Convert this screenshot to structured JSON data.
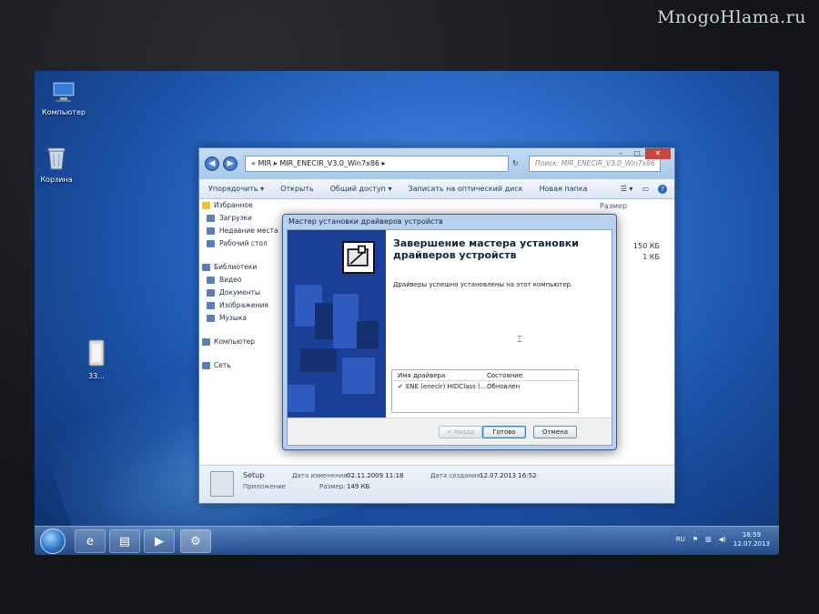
{
  "watermark": "MnogoHlama.ru",
  "desktop": {
    "icons": [
      {
        "label": "Компьютер",
        "icon": "computer-icon"
      },
      {
        "label": "Корзина",
        "icon": "recycle-bin-icon"
      },
      {
        "label": "33...",
        "icon": "folder-icon"
      }
    ]
  },
  "explorer": {
    "address": "«  MIR  ▸  MIR_ENECIR_V3.0_Win7x86  ▸",
    "search_placeholder": "Поиск: MIR_ENECIR_V3.0_Win7x86",
    "toolbar": {
      "organize": "Упорядочить ▾",
      "open": "Открыть",
      "share": "Общий доступ ▾",
      "burn": "Записать на оптический диск",
      "new_folder": "Новая папка"
    },
    "nav": {
      "favorites": "Избранное",
      "downloads": "Загрузки",
      "recent": "Недавние места",
      "desktop": "Рабочий стол",
      "libraries": "Библиотеки",
      "video": "Видео",
      "documents": "Документы",
      "images": "Изображения",
      "music": "Музыка",
      "computer": "Компьютер",
      "network": "Сеть"
    },
    "size_header": "Размер",
    "sizes": [
      "150 КБ",
      "1 КБ"
    ],
    "details": {
      "name": "Setup",
      "type": "Приложение",
      "modified_label": "Дата изменения:",
      "modified_value": "02.11.2009 11:18",
      "size_label": "Размер:",
      "size_value": "149 КБ",
      "created_label": "Дата создания:",
      "created_value": "12.07.2013 16:52"
    }
  },
  "wizard": {
    "title": "Мастер установки драйверов устройств",
    "heading": "Завершение мастера установки драйверов устройств",
    "message": "Драйверы успешно установлены на этот компьютер.",
    "table": {
      "col_name": "Имя драйвера",
      "col_status": "Состояние",
      "rows": [
        {
          "name": "ENE (enecir) HIDClass (...",
          "status": "Обновлен"
        }
      ]
    },
    "buttons": {
      "back": "< Назад",
      "finish": "Готово",
      "cancel": "Отмена"
    }
  },
  "taskbar": {
    "lang": "RU",
    "time": "16:59",
    "date": "12.07.2013"
  }
}
